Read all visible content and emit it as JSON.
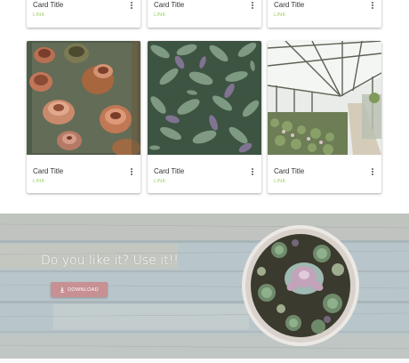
{
  "cards_top": [
    {
      "title": "Card Title",
      "link": "LINK"
    },
    {
      "title": "Card Title",
      "link": "LINK"
    },
    {
      "title": "Card Title",
      "link": "LINK"
    }
  ],
  "cards": [
    {
      "title": "Card Title",
      "link": "LINK",
      "image": "terracotta-pots-photo"
    },
    {
      "title": "Card Title",
      "link": "LINK",
      "image": "sage-leaves-photo"
    },
    {
      "title": "Card Title",
      "link": "LINK",
      "image": "greenhouse-photo"
    }
  ],
  "hero": {
    "headline": "Do you like it? Use it!!",
    "button_label": "DOWNLOAD",
    "button_icon": "download-icon",
    "image": "succulent-bowl-photo"
  },
  "colors": {
    "link": "#9ccc65",
    "button": "#c79092",
    "wood": "#b9c7cc"
  }
}
